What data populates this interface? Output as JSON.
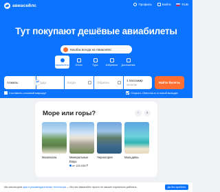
{
  "header": {
    "logo_text": "авиасейлс",
    "nav": [
      {
        "label": "Профиль"
      },
      {
        "label": "Войти"
      },
      {
        "label": "RUB"
      }
    ]
  },
  "hero": {
    "title": "Тут покупают дешёвые авиабилеты",
    "promo_pill": "Кешбэк всегда на Авиасейлс",
    "tabs": [
      {
        "label": "Авиабилеты",
        "active": true
      },
      {
        "label": "Отели",
        "active": false
      },
      {
        "label": "Туры",
        "active": false
      },
      {
        "label": "Избранное",
        "active": false
      },
      {
        "label": "Достижения",
        "active": false
      }
    ]
  },
  "search": {
    "from_value": "Алматы",
    "to_placeholder": "Куда",
    "depart_placeholder": "Когда",
    "return_placeholder": "Обратно",
    "passengers": "1 пассажир",
    "cabin_class": "эконом",
    "find_button": "Найти билеты",
    "swap_symbol": "⇄",
    "checkbox_left": "Составить сложный маршрут",
    "checkbox_right": "Открыть Ostrovok.ru в новой вкладке"
  },
  "section": {
    "title": "Море или горы?",
    "prev": "‹",
    "next": "›",
    "destinations": [
      {
        "name": "Махачкала",
        "price": ""
      },
      {
        "name": "Минеральные Воды",
        "price": "от 125 035 ₸"
      },
      {
        "name": "Черногория",
        "price": ""
      },
      {
        "name": "Мальдивы",
        "price": ""
      }
    ]
  },
  "cookie": {
    "text_before": "Мы используем",
    "link": "куки и рекомендательные технологии",
    "text_after": "— без них Авиасейлс просто не сможет нормально работать.",
    "button": "Да без проблем"
  },
  "colors": {
    "brand_blue": "#0c73fe",
    "accent_orange": "#ff6f32",
    "page_bg": "#eff1f4"
  }
}
